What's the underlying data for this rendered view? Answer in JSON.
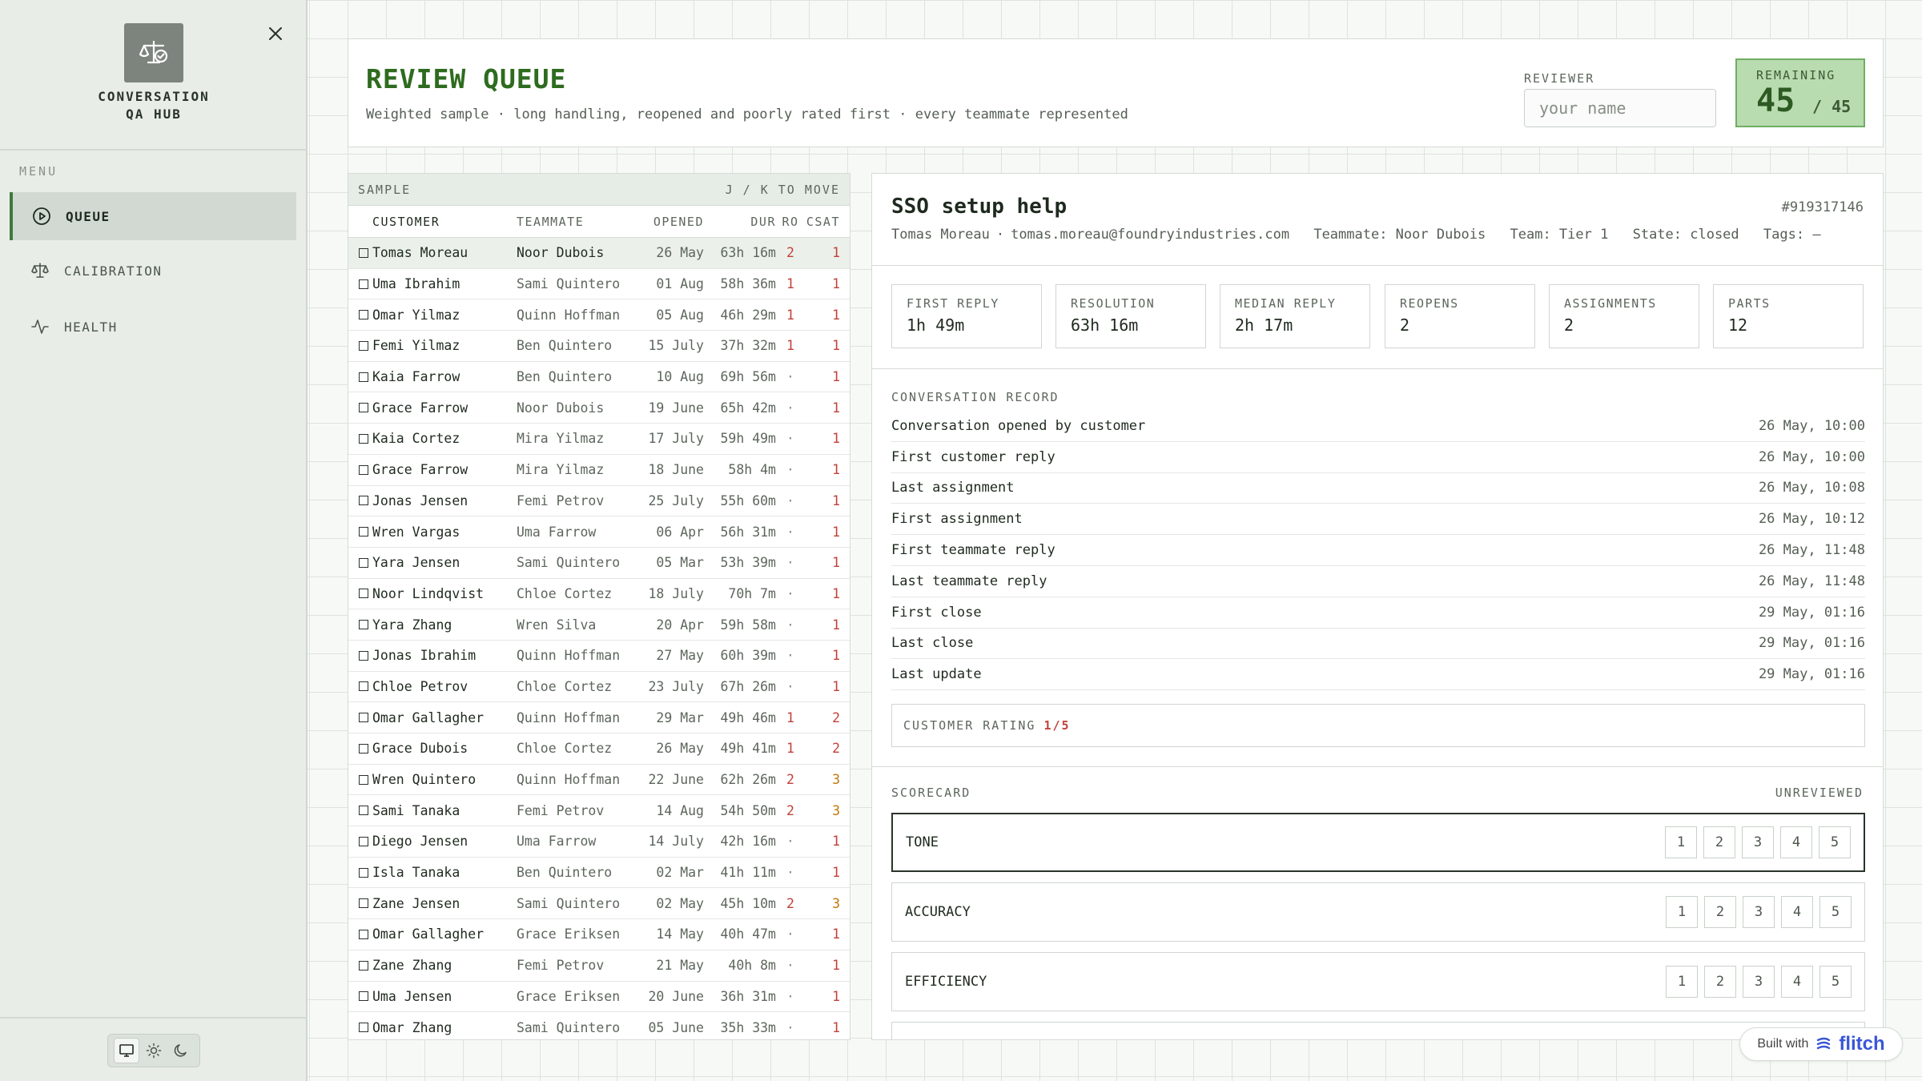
{
  "sidebar": {
    "brand": "CONVERSATION\nQA HUB",
    "menu_label": "MENU",
    "items": [
      {
        "label": "QUEUE",
        "icon": "play-circle-icon",
        "active": true
      },
      {
        "label": "CALIBRATION",
        "icon": "scale-icon",
        "active": false
      },
      {
        "label": "HEALTH",
        "icon": "pulse-icon",
        "active": false
      }
    ]
  },
  "header": {
    "title": "REVIEW QUEUE",
    "subtitle": "Weighted sample · long handling, reopened and poorly rated first · every teammate represented",
    "reviewer_label": "REVIEWER",
    "reviewer_placeholder": "your name",
    "remaining_label": "REMAINING",
    "remaining_count": "45",
    "remaining_total": "/ 45"
  },
  "sample": {
    "title": "SAMPLE",
    "hint": "J / K TO MOVE",
    "columns": [
      "CUSTOMER",
      "TEAMMATE",
      "OPENED",
      "DUR",
      "RO",
      "CSAT"
    ],
    "rows": [
      {
        "customer": "Tomas Moreau",
        "teammate": "Noor Dubois",
        "opened": "26 May",
        "dur": "63h 16m",
        "ro": "2",
        "csat": "1"
      },
      {
        "customer": "Uma Ibrahim",
        "teammate": "Sami Quintero",
        "opened": "01 Aug",
        "dur": "58h 36m",
        "ro": "1",
        "csat": "1"
      },
      {
        "customer": "Omar Yilmaz",
        "teammate": "Quinn Hoffman",
        "opened": "05 Aug",
        "dur": "46h 29m",
        "ro": "1",
        "csat": "1"
      },
      {
        "customer": "Femi Yilmaz",
        "teammate": "Ben Quintero",
        "opened": "15 July",
        "dur": "37h 32m",
        "ro": "1",
        "csat": "1"
      },
      {
        "customer": "Kaia Farrow",
        "teammate": "Ben Quintero",
        "opened": "10 Aug",
        "dur": "69h 56m",
        "ro": "·",
        "csat": "1"
      },
      {
        "customer": "Grace Farrow",
        "teammate": "Noor Dubois",
        "opened": "19 June",
        "dur": "65h 42m",
        "ro": "·",
        "csat": "1"
      },
      {
        "customer": "Kaia Cortez",
        "teammate": "Mira Yilmaz",
        "opened": "17 July",
        "dur": "59h 49m",
        "ro": "·",
        "csat": "1"
      },
      {
        "customer": "Grace Farrow",
        "teammate": "Mira Yilmaz",
        "opened": "18 June",
        "dur": "58h 4m",
        "ro": "·",
        "csat": "1"
      },
      {
        "customer": "Jonas Jensen",
        "teammate": "Femi Petrov",
        "opened": "25 July",
        "dur": "55h 60m",
        "ro": "·",
        "csat": "1"
      },
      {
        "customer": "Wren Vargas",
        "teammate": "Uma Farrow",
        "opened": "06 Apr",
        "dur": "56h 31m",
        "ro": "·",
        "csat": "1"
      },
      {
        "customer": "Yara Jensen",
        "teammate": "Sami Quintero",
        "opened": "05 Mar",
        "dur": "53h 39m",
        "ro": "·",
        "csat": "1"
      },
      {
        "customer": "Noor Lindqvist",
        "teammate": "Chloe Cortez",
        "opened": "18 July",
        "dur": "70h 7m",
        "ro": "·",
        "csat": "1"
      },
      {
        "customer": "Yara Zhang",
        "teammate": "Wren Silva",
        "opened": "20 Apr",
        "dur": "59h 58m",
        "ro": "·",
        "csat": "1"
      },
      {
        "customer": "Jonas Ibrahim",
        "teammate": "Quinn Hoffman",
        "opened": "27 May",
        "dur": "60h 39m",
        "ro": "·",
        "csat": "1"
      },
      {
        "customer": "Chloe Petrov",
        "teammate": "Chloe Cortez",
        "opened": "23 July",
        "dur": "67h 26m",
        "ro": "·",
        "csat": "1"
      },
      {
        "customer": "Omar Gallagher",
        "teammate": "Quinn Hoffman",
        "opened": "29 Mar",
        "dur": "49h 46m",
        "ro": "1",
        "csat": "2"
      },
      {
        "customer": "Grace Dubois",
        "teammate": "Chloe Cortez",
        "opened": "26 May",
        "dur": "49h 41m",
        "ro": "1",
        "csat": "2"
      },
      {
        "customer": "Wren Quintero",
        "teammate": "Quinn Hoffman",
        "opened": "22 June",
        "dur": "62h 26m",
        "ro": "2",
        "csat": "3"
      },
      {
        "customer": "Sami Tanaka",
        "teammate": "Femi Petrov",
        "opened": "14 Aug",
        "dur": "54h 50m",
        "ro": "2",
        "csat": "3"
      },
      {
        "customer": "Diego Jensen",
        "teammate": "Uma Farrow",
        "opened": "14 July",
        "dur": "42h 16m",
        "ro": "·",
        "csat": "1"
      },
      {
        "customer": "Isla Tanaka",
        "teammate": "Ben Quintero",
        "opened": "02 Mar",
        "dur": "41h 11m",
        "ro": "·",
        "csat": "1"
      },
      {
        "customer": "Zane Jensen",
        "teammate": "Sami Quintero",
        "opened": "02 May",
        "dur": "45h 10m",
        "ro": "2",
        "csat": "3"
      },
      {
        "customer": "Omar Gallagher",
        "teammate": "Grace Eriksen",
        "opened": "14 May",
        "dur": "40h 47m",
        "ro": "·",
        "csat": "1"
      },
      {
        "customer": "Zane Zhang",
        "teammate": "Femi Petrov",
        "opened": "21 May",
        "dur": "40h 8m",
        "ro": "·",
        "csat": "1"
      },
      {
        "customer": "Uma Jensen",
        "teammate": "Grace Eriksen",
        "opened": "20 June",
        "dur": "36h 31m",
        "ro": "·",
        "csat": "1"
      },
      {
        "customer": "Omar Zhang",
        "teammate": "Sami Quintero",
        "opened": "05 June",
        "dur": "35h 33m",
        "ro": "·",
        "csat": "1"
      }
    ]
  },
  "detail": {
    "title": "SSO setup help",
    "id": "#919317146",
    "meta": {
      "customer": "Tomas Moreau",
      "email": "tomas.moreau@foundryindustries.com",
      "teammate": "Teammate: Noor Dubois",
      "team": "Team: Tier 1",
      "state": "State: closed",
      "tags": "Tags: —"
    },
    "stats": [
      {
        "label": "FIRST REPLY",
        "value": "1h 49m"
      },
      {
        "label": "RESOLUTION",
        "value": "63h 16m"
      },
      {
        "label": "MEDIAN REPLY",
        "value": "2h 17m"
      },
      {
        "label": "REOPENS",
        "value": "2"
      },
      {
        "label": "ASSIGNMENTS",
        "value": "2"
      },
      {
        "label": "PARTS",
        "value": "12"
      }
    ],
    "record_label": "CONVERSATION RECORD",
    "record": [
      {
        "event": "Conversation opened by customer",
        "time": "26 May, 10:00"
      },
      {
        "event": "First customer reply",
        "time": "26 May, 10:00"
      },
      {
        "event": "Last assignment",
        "time": "26 May, 10:08"
      },
      {
        "event": "First assignment",
        "time": "26 May, 10:12"
      },
      {
        "event": "First teammate reply",
        "time": "26 May, 11:48"
      },
      {
        "event": "Last teammate reply",
        "time": "26 May, 11:48"
      },
      {
        "event": "First close",
        "time": "29 May, 01:16"
      },
      {
        "event": "Last close",
        "time": "29 May, 01:16"
      },
      {
        "event": "Last update",
        "time": "29 May, 01:16"
      }
    ],
    "rating_label": "CUSTOMER RATING",
    "rating_value": "1/5",
    "scorecard_label": "SCORECARD",
    "scorecard_status": "UNREVIEWED",
    "criteria": [
      {
        "label": "TONE"
      },
      {
        "label": "ACCURACY"
      },
      {
        "label": "EFFICIENCY"
      }
    ],
    "score_options": [
      "1",
      "2",
      "3",
      "4",
      "5"
    ]
  },
  "badge": {
    "text": "Built with",
    "brand": "flitch"
  },
  "colors": {
    "accent": "#2e6b1f",
    "remaining_bg": "#b9dbb0",
    "alert": "#c2413a",
    "warn": "#c0780a",
    "brand_blue": "#3a57d6"
  }
}
